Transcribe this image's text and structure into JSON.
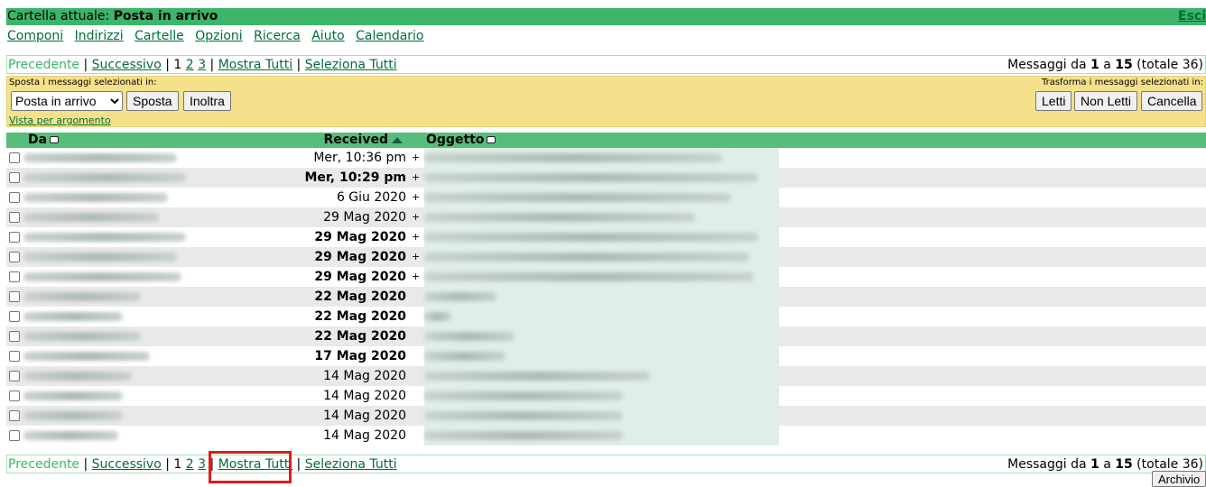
{
  "topbar": {
    "current_folder_label": "Cartella attuale: ",
    "current_folder": "Posta in arrivo",
    "logout": "Esci"
  },
  "menu": [
    "Componi",
    "Indirizzi",
    "Cartelle",
    "Opzioni",
    "Ricerca",
    "Aiuto",
    "Calendario"
  ],
  "nav": {
    "prev": "Precedente",
    "next": "Successivo",
    "pages": [
      "1",
      "2",
      "3"
    ],
    "show_all": "Mostra Tutti",
    "select_all": "Seleziona Tutti",
    "count_prefix": "Messaggi da ",
    "count_from": "1",
    "count_mid": " a ",
    "count_to": "15",
    "count_suffix": " (totale 36)"
  },
  "actions": {
    "move_label": "Sposta i messaggi selezionati in:",
    "folder_selected": "Posta in arrivo",
    "move_button": "Sposta",
    "forward_button": "Inoltra",
    "transform_label": "Trasforma i messaggi selezionati in:",
    "read_button": "Letti",
    "unread_button": "Non Letti",
    "delete_button": "Cancella",
    "thread_view": "Vista per argomento"
  },
  "table": {
    "col_from": "Da",
    "col_received": "Received",
    "col_subject": "Oggetto",
    "rows": [
      {
        "date": "Mer, 10:36 pm",
        "unread": false,
        "attachment": "+"
      },
      {
        "date": "Mer, 10:29 pm",
        "unread": true,
        "attachment": "+"
      },
      {
        "date": "6 Giu 2020",
        "unread": false,
        "attachment": "+"
      },
      {
        "date": "29 Mag 2020",
        "unread": false,
        "attachment": "+"
      },
      {
        "date": "29 Mag 2020",
        "unread": true,
        "attachment": "+"
      },
      {
        "date": "29 Mag 2020",
        "unread": true,
        "attachment": "+"
      },
      {
        "date": "29 Mag 2020",
        "unread": true,
        "attachment": "+"
      },
      {
        "date": "22 Mag 2020",
        "unread": true,
        "attachment": ""
      },
      {
        "date": "22 Mag 2020",
        "unread": true,
        "attachment": ""
      },
      {
        "date": "22 Mag 2020",
        "unread": true,
        "attachment": ""
      },
      {
        "date": "17 Mag 2020",
        "unread": true,
        "attachment": ""
      },
      {
        "date": "14 Mag 2020",
        "unread": false,
        "attachment": ""
      },
      {
        "date": "14 Mag 2020",
        "unread": false,
        "attachment": ""
      },
      {
        "date": "14 Mag 2020",
        "unread": false,
        "attachment": ""
      },
      {
        "date": "14 Mag 2020",
        "unread": false,
        "attachment": ""
      }
    ]
  },
  "archive_button": "Archivio",
  "colors": {
    "header_green": "#3cb56a",
    "action_yellow": "#f5e08b",
    "highlight_red": "#e41b1b"
  }
}
